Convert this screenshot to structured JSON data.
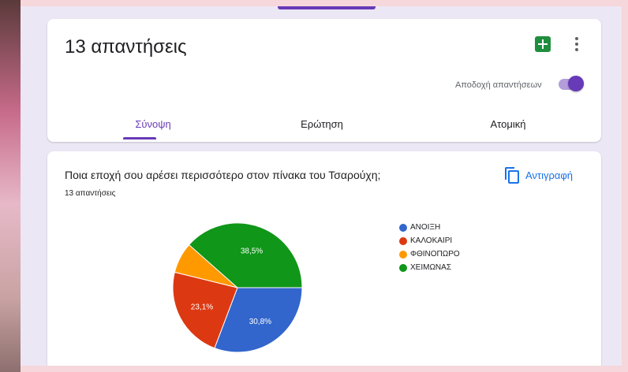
{
  "header": {
    "responses_title": "13 απαντήσεις",
    "accept_label": "Αποδοχή απαντήσεων",
    "accept_on": true,
    "tabs": [
      {
        "label": "Σύνοψη",
        "active": true
      },
      {
        "label": "Ερώτηση",
        "active": false
      },
      {
        "label": "Ατομική",
        "active": false
      }
    ]
  },
  "question": {
    "title": "Ποια εποχή σου αρέσει περισσότερο στον πίνακα του Τσαρούχη;",
    "count": "13 απαντήσεις",
    "copy_label": "Αντιγραφή"
  },
  "colors": {
    "accent": "#673ab7",
    "link": "#1a73e8",
    "sheets": "#1e8e3e"
  },
  "chart_data": {
    "type": "pie",
    "categories": [
      "ΑΝΟΙΞΗ",
      "ΚΑΛΟΚΑΙΡΙ",
      "ΦΘΙΝΟΠΩΡΟ",
      "ΧΕΙΜΩΝΑΣ"
    ],
    "values": [
      30.8,
      23.1,
      7.7,
      38.5
    ],
    "labels": [
      "30,8%",
      "23,1%",
      "",
      "38,5%"
    ],
    "colors": [
      "#3366cc",
      "#dc3912",
      "#ff9900",
      "#109618"
    ],
    "legend_position": "right"
  }
}
